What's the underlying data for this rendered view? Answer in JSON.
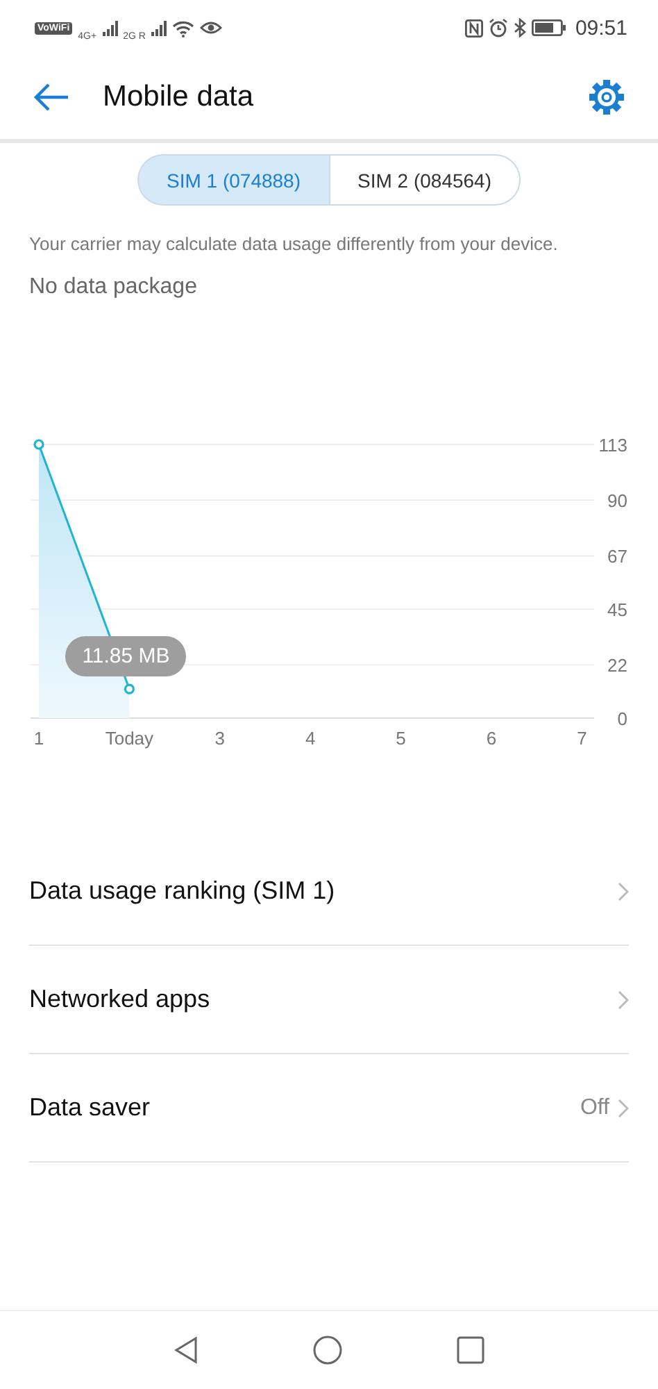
{
  "status_bar": {
    "wifi_calling": "VoWiFi",
    "sim1_network": "4G+",
    "sim2_network": "2G R",
    "time": "09:51"
  },
  "header": {
    "title": "Mobile data"
  },
  "sim_tabs": [
    {
      "label": "SIM 1 (074888)",
      "selected": true
    },
    {
      "label": "SIM 2 (084564)",
      "selected": false
    }
  ],
  "note": "Your carrier may calculate data usage differently from your device.",
  "package": "No data package",
  "usage": {
    "chart_data": {
      "type": "area",
      "categories": [
        "1",
        "Today",
        "3",
        "4",
        "5",
        "6",
        "7"
      ],
      "values": [
        113,
        12,
        null,
        null,
        null,
        null,
        null
      ],
      "ylim": [
        0,
        113
      ],
      "yticks": [
        0,
        22,
        45,
        67,
        90,
        113
      ],
      "grid": true,
      "annotations": [
        "11.85 MB"
      ]
    }
  },
  "menu": [
    {
      "label": "Data usage ranking (SIM 1)"
    },
    {
      "label": "Networked apps"
    },
    {
      "label": "Data saver",
      "value": "Off"
    }
  ]
}
